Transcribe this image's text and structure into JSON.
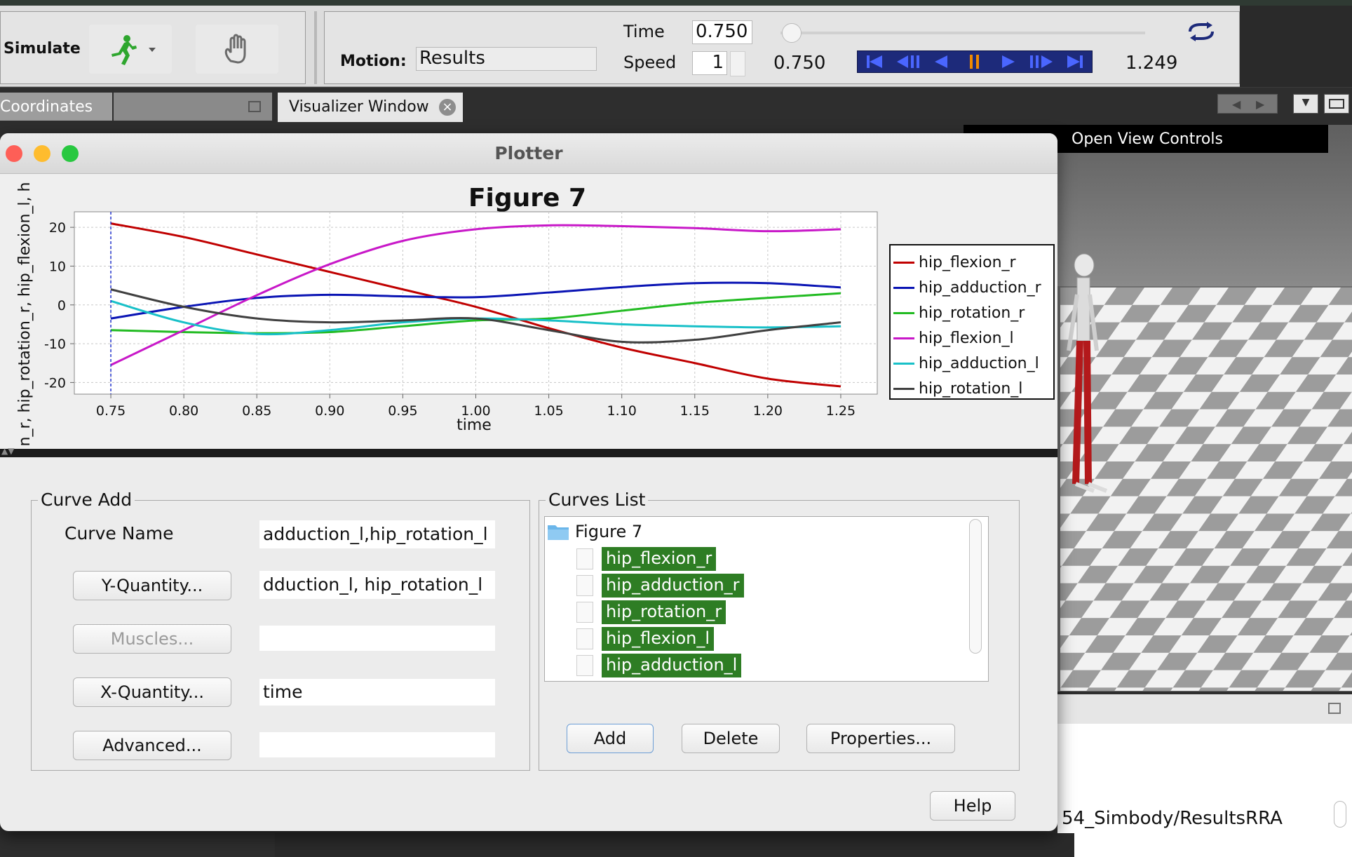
{
  "toolbar": {
    "simulate_label": "Simulate",
    "motion_label": "Motion:",
    "motion_value": "Results",
    "time_label": "Time",
    "time_value": "0.750",
    "speed_label": "Speed",
    "speed_value": "1",
    "current_time": "0.750",
    "end_time": "1.249"
  },
  "dock": {
    "tab_coordinates": "Coordinates",
    "tab_visualizer": "Visualizer Window",
    "open_view_controls": "Open View Controls",
    "console_path": "54_Simbody/ResultsRRA"
  },
  "plotter": {
    "title": "Plotter",
    "curve_add": {
      "group_title": "Curve Add",
      "curve_name_label": "Curve Name",
      "curve_name_value": "adduction_l,hip_rotation_l",
      "y_quantity_button": "Y-Quantity...",
      "y_quantity_value": "dduction_l, hip_rotation_l",
      "muscles_button": "Muscles...",
      "muscles_value": "",
      "x_quantity_button": "X-Quantity...",
      "x_quantity_value": "time",
      "advanced_button": "Advanced...",
      "advanced_value": ""
    },
    "curves_list": {
      "group_title": "Curves List",
      "figure_name": "Figure 7",
      "items": [
        "hip_flexion_r",
        "hip_adduction_r",
        "hip_rotation_r",
        "hip_flexion_l",
        "hip_adduction_l"
      ],
      "add_button": "Add",
      "delete_button": "Delete",
      "properties_button": "Properties..."
    },
    "help_button": "Help"
  },
  "colors": {
    "selection": "#2e7d24",
    "transport_bg": "#1d2a7a",
    "pause_accent": "#f08a00",
    "run_icon": "#2ea62e"
  },
  "chart_data": {
    "type": "line",
    "title": "Figure 7",
    "xlabel": "time",
    "ylabel": "n_r, hip_rotation_r, hip_flexion_l, h",
    "xlim": [
      0.725,
      1.275
    ],
    "ylim": [
      -23,
      24
    ],
    "x_ticks": [
      "0.75",
      "0.80",
      "0.85",
      "0.90",
      "0.95",
      "1.00",
      "1.05",
      "1.10",
      "1.15",
      "1.20",
      "1.25"
    ],
    "y_ticks": [
      "20",
      "10",
      "0",
      "-10",
      "-20"
    ],
    "grid": true,
    "cursor_x": 0.75,
    "legend_position": "right",
    "x": [
      0.75,
      0.8,
      0.85,
      0.9,
      0.95,
      1.0,
      1.05,
      1.1,
      1.15,
      1.2,
      1.25
    ],
    "series": [
      {
        "name": "hip_flexion_r",
        "color": "#c00000",
        "values": [
          21,
          17.5,
          13,
          8.5,
          4,
          -0.5,
          -6,
          -11,
          -15,
          -19,
          -21
        ]
      },
      {
        "name": "hip_adduction_r",
        "color": "#0a14b4",
        "values": [
          -3.5,
          -0.5,
          1.8,
          2.6,
          2.2,
          2.0,
          3.2,
          4.6,
          5.6,
          5.6,
          4.5
        ]
      },
      {
        "name": "hip_rotation_r",
        "color": "#22bb22",
        "values": [
          -6.5,
          -7.0,
          -7.3,
          -7.0,
          -5.5,
          -4.0,
          -3.5,
          -1.5,
          0.5,
          1.8,
          3.0
        ]
      },
      {
        "name": "hip_flexion_l",
        "color": "#c818c8",
        "values": [
          -15.5,
          -6.5,
          2.5,
          10.5,
          16.5,
          19.5,
          20.5,
          20.3,
          19.8,
          19.0,
          19.5
        ]
      },
      {
        "name": "hip_adduction_l",
        "color": "#18c0c8",
        "values": [
          1.0,
          -4.5,
          -7.5,
          -6.5,
          -4.5,
          -3.5,
          -4.0,
          -5.0,
          -5.5,
          -5.8,
          -5.5
        ]
      },
      {
        "name": "hip_rotation_l",
        "color": "#404040",
        "values": [
          4.0,
          -0.5,
          -3.5,
          -4.5,
          -4.0,
          -3.5,
          -6.5,
          -9.5,
          -9.0,
          -6.5,
          -4.5
        ]
      }
    ]
  }
}
